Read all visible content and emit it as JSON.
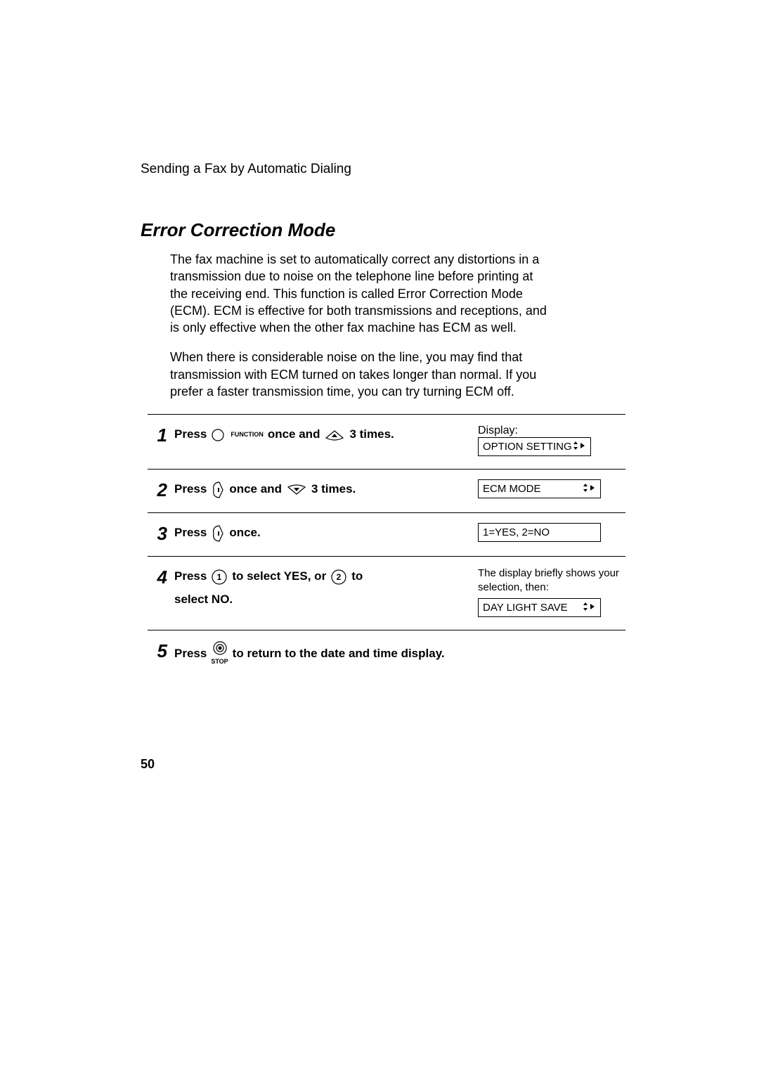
{
  "header": "Sending a Fax by Automatic Dialing",
  "section_title": "Error Correction Mode",
  "para1": "The fax machine is set to automatically correct any distortions in a transmission due to noise on the telephone line before printing at the receiving end. This function is called Error Correction Mode (ECM). ECM is effective for both transmissions and receptions, and is only effective when the other fax machine has ECM as well.",
  "para2": "When there is considerable noise on the line, you may find that transmission with ECM turned on takes longer than normal. If you prefer a faster transmission time, you can try turning ECM off.",
  "labels": {
    "press": "Press",
    "function": "FUNCTION",
    "stop": "STOP",
    "display": "Display:"
  },
  "steps": {
    "s1": {
      "num": "1",
      "t_once_and": "once and",
      "t_3times": "3 times.",
      "lcd": "OPTION SETTING"
    },
    "s2": {
      "num": "2",
      "t_once_and": "once and",
      "t_3times": "3 times.",
      "lcd": "ECM MODE"
    },
    "s3": {
      "num": "3",
      "t_once": "once.",
      "lcd": "1=YES, 2=NO"
    },
    "s4": {
      "num": "4",
      "key1": "1",
      "key2": "2",
      "t_select_yes": "to select YES, or",
      "t_to": "to",
      "t_select_no": "select NO.",
      "note": "The display briefly shows your selection, then:",
      "lcd": "DAY LIGHT SAVE"
    },
    "s5": {
      "num": "5",
      "t_return": "to return to the date and time display."
    }
  },
  "page_number": "50"
}
